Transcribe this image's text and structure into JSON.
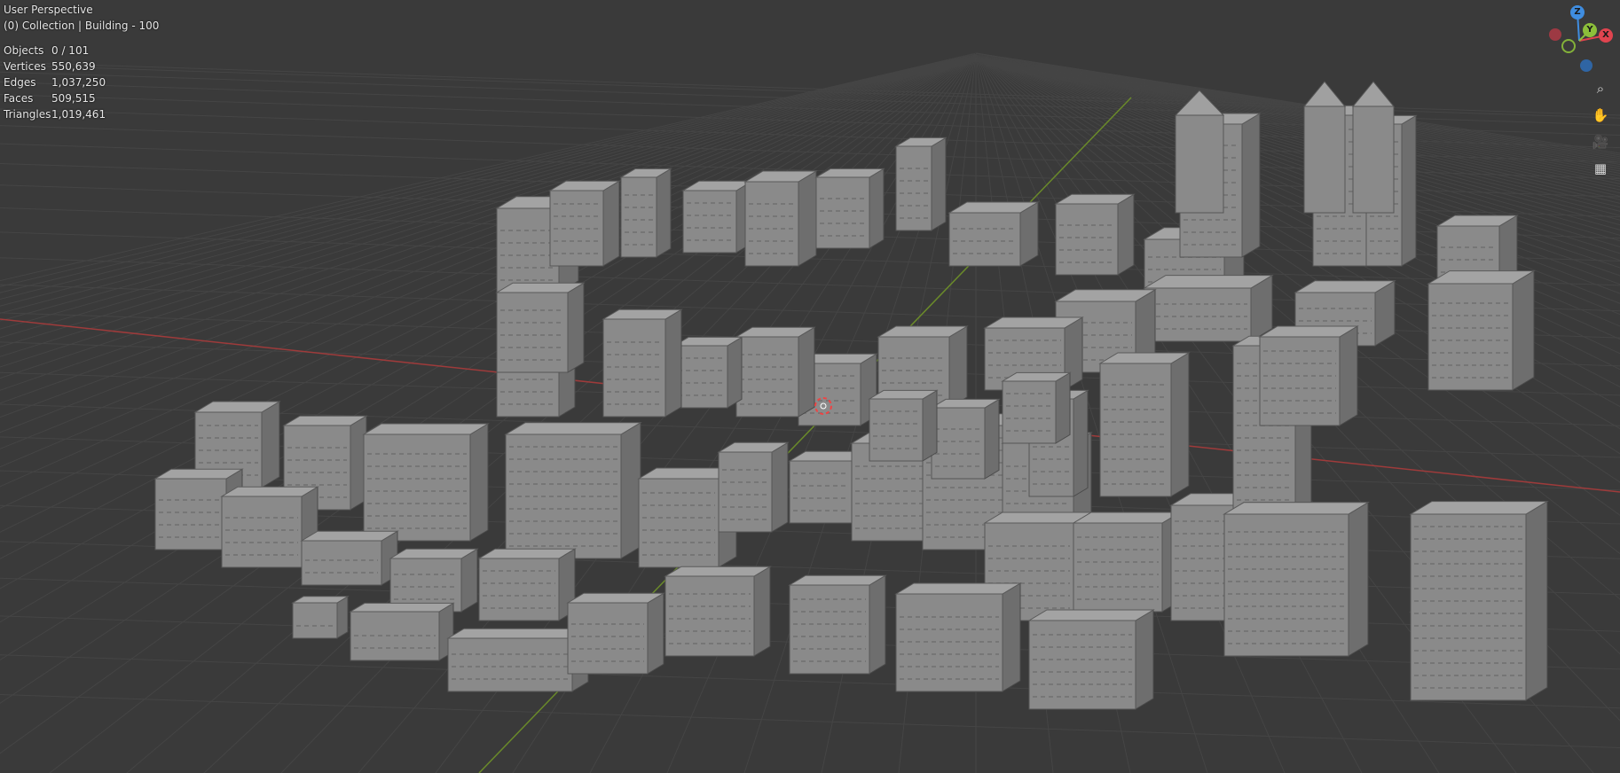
{
  "viewport": {
    "view_name": "User Perspective",
    "collection_label": "(0) Collection | Building - 100",
    "stats": [
      {
        "label": "Objects",
        "value": "0 / 101"
      },
      {
        "label": "Vertices",
        "value": "550,639"
      },
      {
        "label": "Edges",
        "value": "1,037,250"
      },
      {
        "label": "Faces",
        "value": "509,515"
      },
      {
        "label": "Triangles",
        "value": "1,019,461"
      }
    ]
  },
  "gizmo": {
    "x_label": "X",
    "y_label": "Y",
    "z_label": "Z",
    "colors": {
      "x": "#e0444f",
      "y": "#8cbf3a",
      "z": "#3f8de0"
    }
  },
  "nav_tools": [
    {
      "name": "zoom-icon",
      "glyph": "⌕"
    },
    {
      "name": "pan-hand-icon",
      "glyph": "✋"
    },
    {
      "name": "camera-icon",
      "glyph": "🎥"
    },
    {
      "name": "grid-ortho-icon",
      "glyph": "▦"
    }
  ],
  "theme": {
    "background": "#3a3a3a",
    "grid_line": "#454545",
    "x_axis": "#9e3b3b",
    "y_axis": "#6a8a2a",
    "building": "#8a8a8a"
  }
}
